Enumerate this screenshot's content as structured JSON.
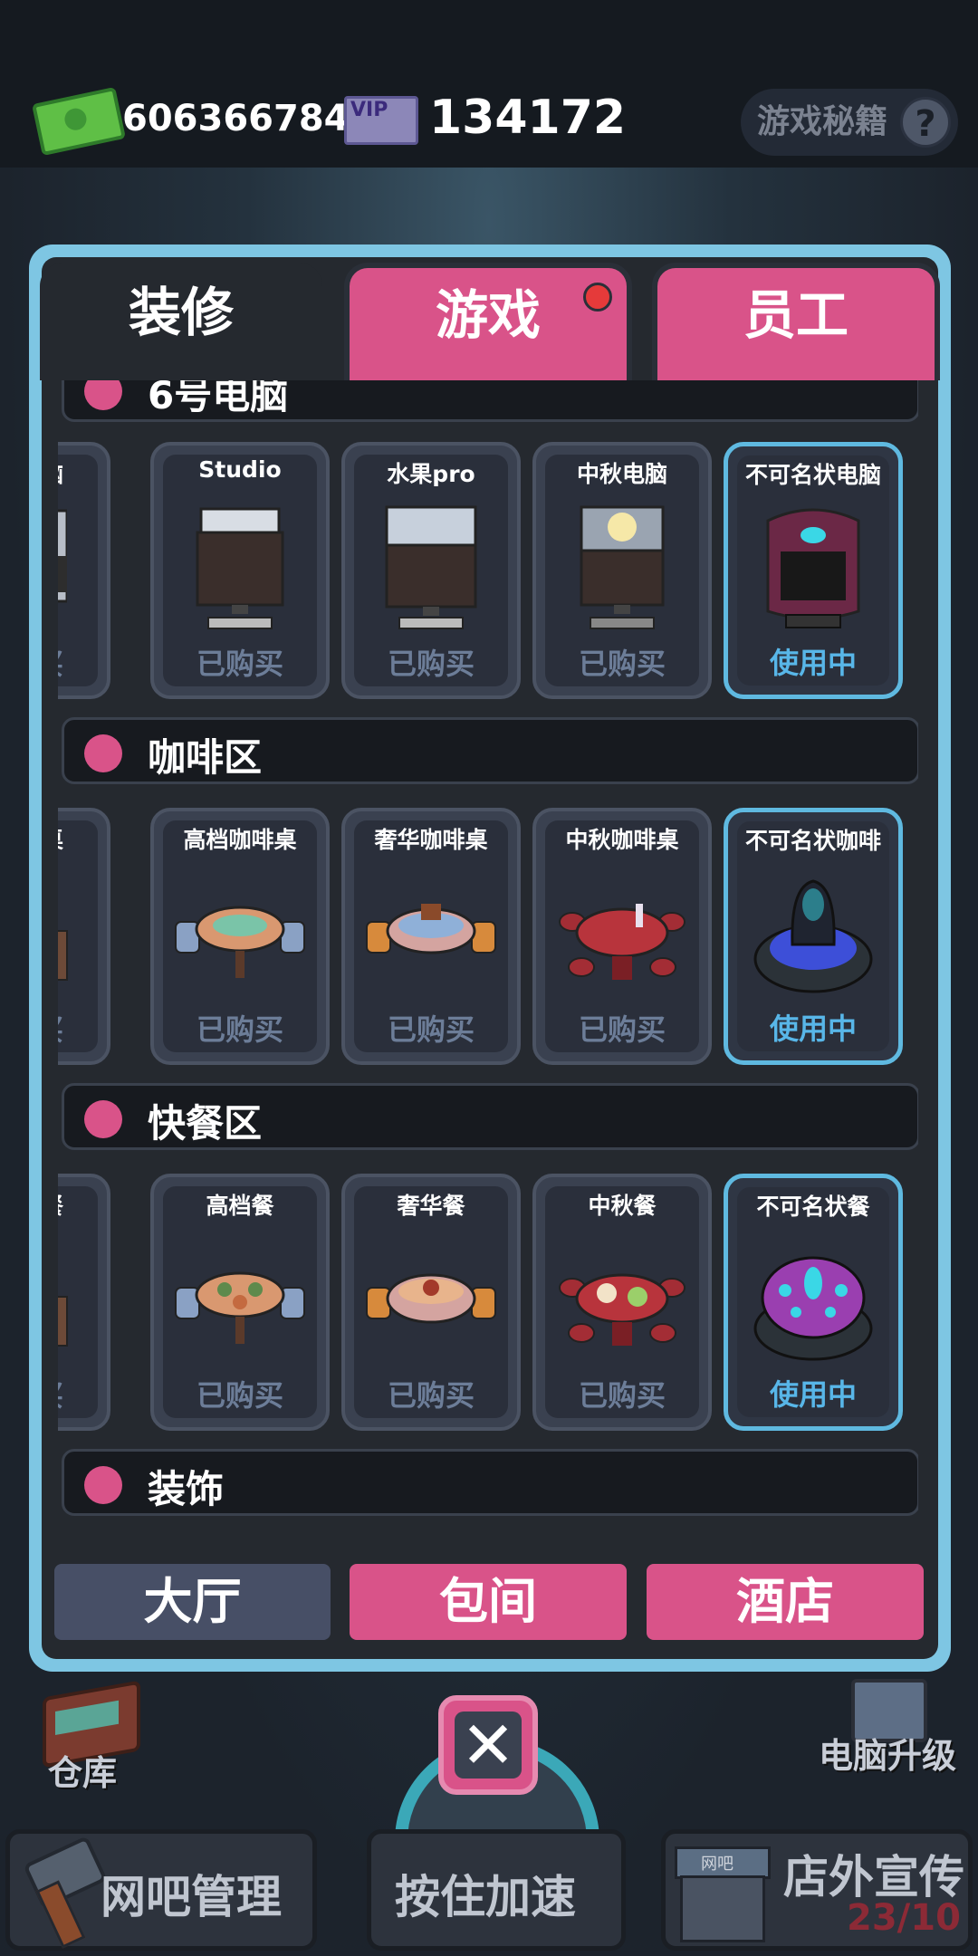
{
  "header": {
    "money": "606366784",
    "vip_label": "VIP",
    "vip_points": "134172",
    "secrets_label": "游戏秘籍",
    "help_glyph": "?"
  },
  "tabs": [
    {
      "label": "装修",
      "active": true
    },
    {
      "label": "游戏",
      "active": false,
      "has_notification": true
    },
    {
      "label": "员工",
      "active": false
    }
  ],
  "categories": [
    {
      "name": "6号电脑",
      "items": [
        {
          "title": "脑",
          "status": "买"
        },
        {
          "title": "Studio",
          "status": "已购买"
        },
        {
          "title": "水果pro",
          "status": "已购买"
        },
        {
          "title": "中秋电脑",
          "status": "已购买"
        },
        {
          "title": "不可名状电脑",
          "status": "使用中",
          "selected": true
        }
      ]
    },
    {
      "name": "咖啡区",
      "items": [
        {
          "title": "啡桌",
          "status": "买"
        },
        {
          "title": "高档咖啡桌",
          "status": "已购买"
        },
        {
          "title": "奢华咖啡桌",
          "status": "已购买"
        },
        {
          "title": "中秋咖啡桌",
          "status": "已购买"
        },
        {
          "title": "不可名状咖啡",
          "status": "使用中",
          "selected": true
        }
      ]
    },
    {
      "name": "快餐区",
      "items": [
        {
          "title": "餐",
          "status": "买"
        },
        {
          "title": "高档餐",
          "status": "已购买"
        },
        {
          "title": "奢华餐",
          "status": "已购买"
        },
        {
          "title": "中秋餐",
          "status": "已购买"
        },
        {
          "title": "不可名状餐",
          "status": "使用中",
          "selected": true
        }
      ]
    },
    {
      "name": "装饰",
      "items": []
    }
  ],
  "subtabs": [
    "大厅",
    "包间",
    "酒店"
  ],
  "bottom": {
    "close_glyph": "✕",
    "warehouse": "仓库",
    "pc_upgrade": "电脑升级",
    "manage": "网吧管理",
    "speedup": "按住加速",
    "promo": "店外宣传",
    "promo_count": "23/10",
    "shop_sign": "网吧"
  },
  "colors": {
    "accent_pink": "#d95389",
    "panel_border": "#7ec6e3",
    "selected_border": "#5fb9e0",
    "in_use_text": "#58b6e8",
    "owned_text": "#6c7d98"
  }
}
